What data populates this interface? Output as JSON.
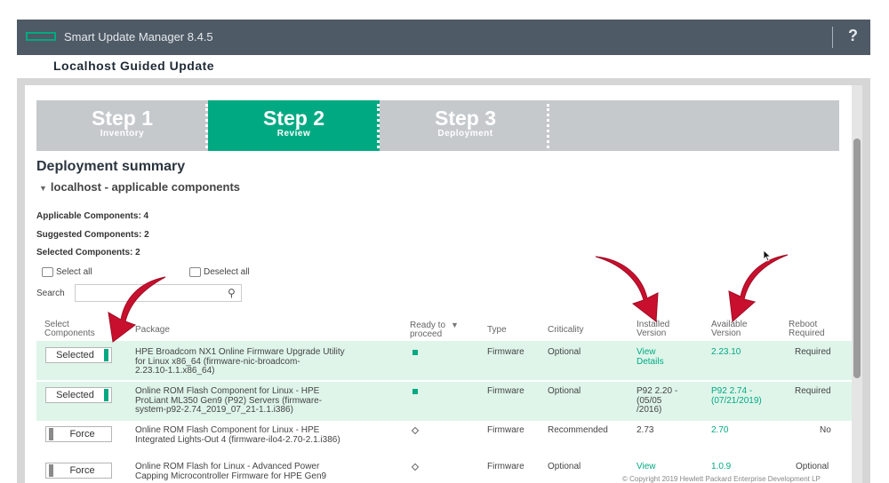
{
  "app": {
    "title": "Smart Update Manager 8.4.5",
    "help_label": "?"
  },
  "page": {
    "title": "Localhost Guided Update"
  },
  "steps": [
    {
      "label": "Step 1",
      "sub": "Inventory"
    },
    {
      "label": "Step 2",
      "sub": "Review"
    },
    {
      "label": "Step 3",
      "sub": "Deployment"
    }
  ],
  "summary": {
    "title": "Deployment summary",
    "host": "localhost - applicable components",
    "applicable": "Applicable Components: 4",
    "suggested": "Suggested Components: 2",
    "selected": "Selected Components: 2"
  },
  "controls": {
    "select_all": "Select all",
    "deselect_all": "Deselect all",
    "search_label": "Search",
    "search_value": ""
  },
  "table": {
    "headers": {
      "select_1": "Select",
      "select_2": "Components",
      "package": "Package",
      "ready_1": "Ready to",
      "ready_2": "proceed",
      "type": "Type",
      "criticality": "Criticality",
      "installed_1": "Installed",
      "installed_2": "Version",
      "available_1": "Available",
      "available_2": "Version",
      "reboot_1": "Reboot",
      "reboot_2": "Required"
    },
    "rows": [
      {
        "button": "Selected",
        "pkg_1": "HPE Broadcom NX1 Online Firmware Upgrade Utility",
        "pkg_2": "for Linux x86_64 (firmware-nic-broadcom-",
        "pkg_3": "2.23.10-1.1.x86_64)",
        "type": "Firmware",
        "criticality": "Optional",
        "installed_1": "View",
        "installed_2": "Details",
        "installed_3": "",
        "available_1": "2.23.10",
        "available_2": "",
        "reboot": "Required"
      },
      {
        "button": "Selected",
        "pkg_1": "Online ROM Flash Component for Linux - HPE",
        "pkg_2": "ProLiant ML350 Gen9 (P92) Servers (firmware-",
        "pkg_3": "system-p92-2.74_2019_07_21-1.1.i386)",
        "type": "Firmware",
        "criticality": "Optional",
        "installed_1": "P92 2.20 -",
        "installed_2": "(05/05",
        "installed_3": "/2016)",
        "available_1": "P92 2.74 -",
        "available_2": "(07/21/2019)",
        "reboot": "Required"
      },
      {
        "button": "Force",
        "pkg_1": "Online ROM Flash Component for Linux - HPE",
        "pkg_2": "Integrated Lights-Out 4 (firmware-ilo4-2.70-2.1.i386)",
        "pkg_3": "",
        "type": "Firmware",
        "criticality": "Recommended",
        "installed_1": "2.73",
        "installed_2": "",
        "installed_3": "",
        "available_1": "2.70",
        "available_2": "",
        "reboot": "No"
      },
      {
        "button": "Force",
        "pkg_1": "Online ROM Flash for Linux - Advanced Power",
        "pkg_2": "Capping Microcontroller Firmware for HPE Gen9",
        "pkg_3": "",
        "type": "Firmware",
        "criticality": "Optional",
        "installed_1": "View",
        "installed_2": "",
        "installed_3": "",
        "available_1": "1.0.9",
        "available_2": "",
        "reboot": "Optional"
      }
    ]
  },
  "footer": {
    "copyright": "© Copyright 2019 Hewlett Packard Enterprise Development LP"
  },
  "colors": {
    "accent": "#01a982",
    "header_bg": "#4e5a66",
    "arrow": "#c8102e",
    "selected_row": "#dff5ea"
  },
  "icons": [
    "hpe-logo-icon",
    "help-icon",
    "search-icon",
    "sort-icon",
    "ready-square-icon",
    "ready-diamond-icon",
    "red-arrow-icon",
    "mouse-cursor-icon"
  ]
}
